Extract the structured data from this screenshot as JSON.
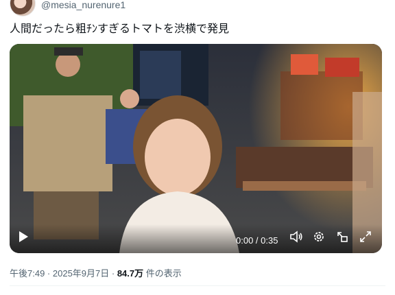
{
  "user": {
    "handle": "@mesia_nurenure1"
  },
  "tweet": {
    "text": "人間だったら粗ﾁﾝすぎるトマトを渋横で発見"
  },
  "video": {
    "time_label": "0:00 / 0:35",
    "icons": [
      "play-icon",
      "volume-icon",
      "settings-icon",
      "dock-icon",
      "fullscreen-icon"
    ]
  },
  "meta": {
    "time": "午後7:49",
    "sep1": " · ",
    "date": "2025年9月7日",
    "sep2": " · ",
    "views": "84.7万",
    "views_suffix": " 件の表示"
  }
}
